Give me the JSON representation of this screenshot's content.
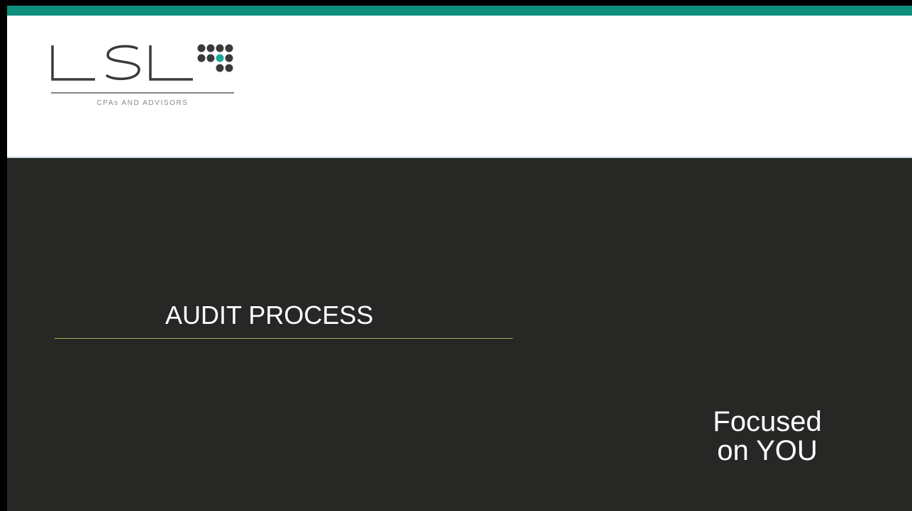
{
  "logo": {
    "wordmark": "LSL",
    "subtitle": "CPAs AND ADVISORS",
    "dot_color": "#3a3a3a",
    "accent_dot_color": "#1aa89a"
  },
  "slide": {
    "title": "AUDIT PROCESS",
    "tagline_line1": "Focused",
    "tagline_line2": "on YOU"
  },
  "colors": {
    "top_bar": "#0f8e7e",
    "body_background": "#272725",
    "title_rule": "#a3b553",
    "text": "#ffffff"
  }
}
